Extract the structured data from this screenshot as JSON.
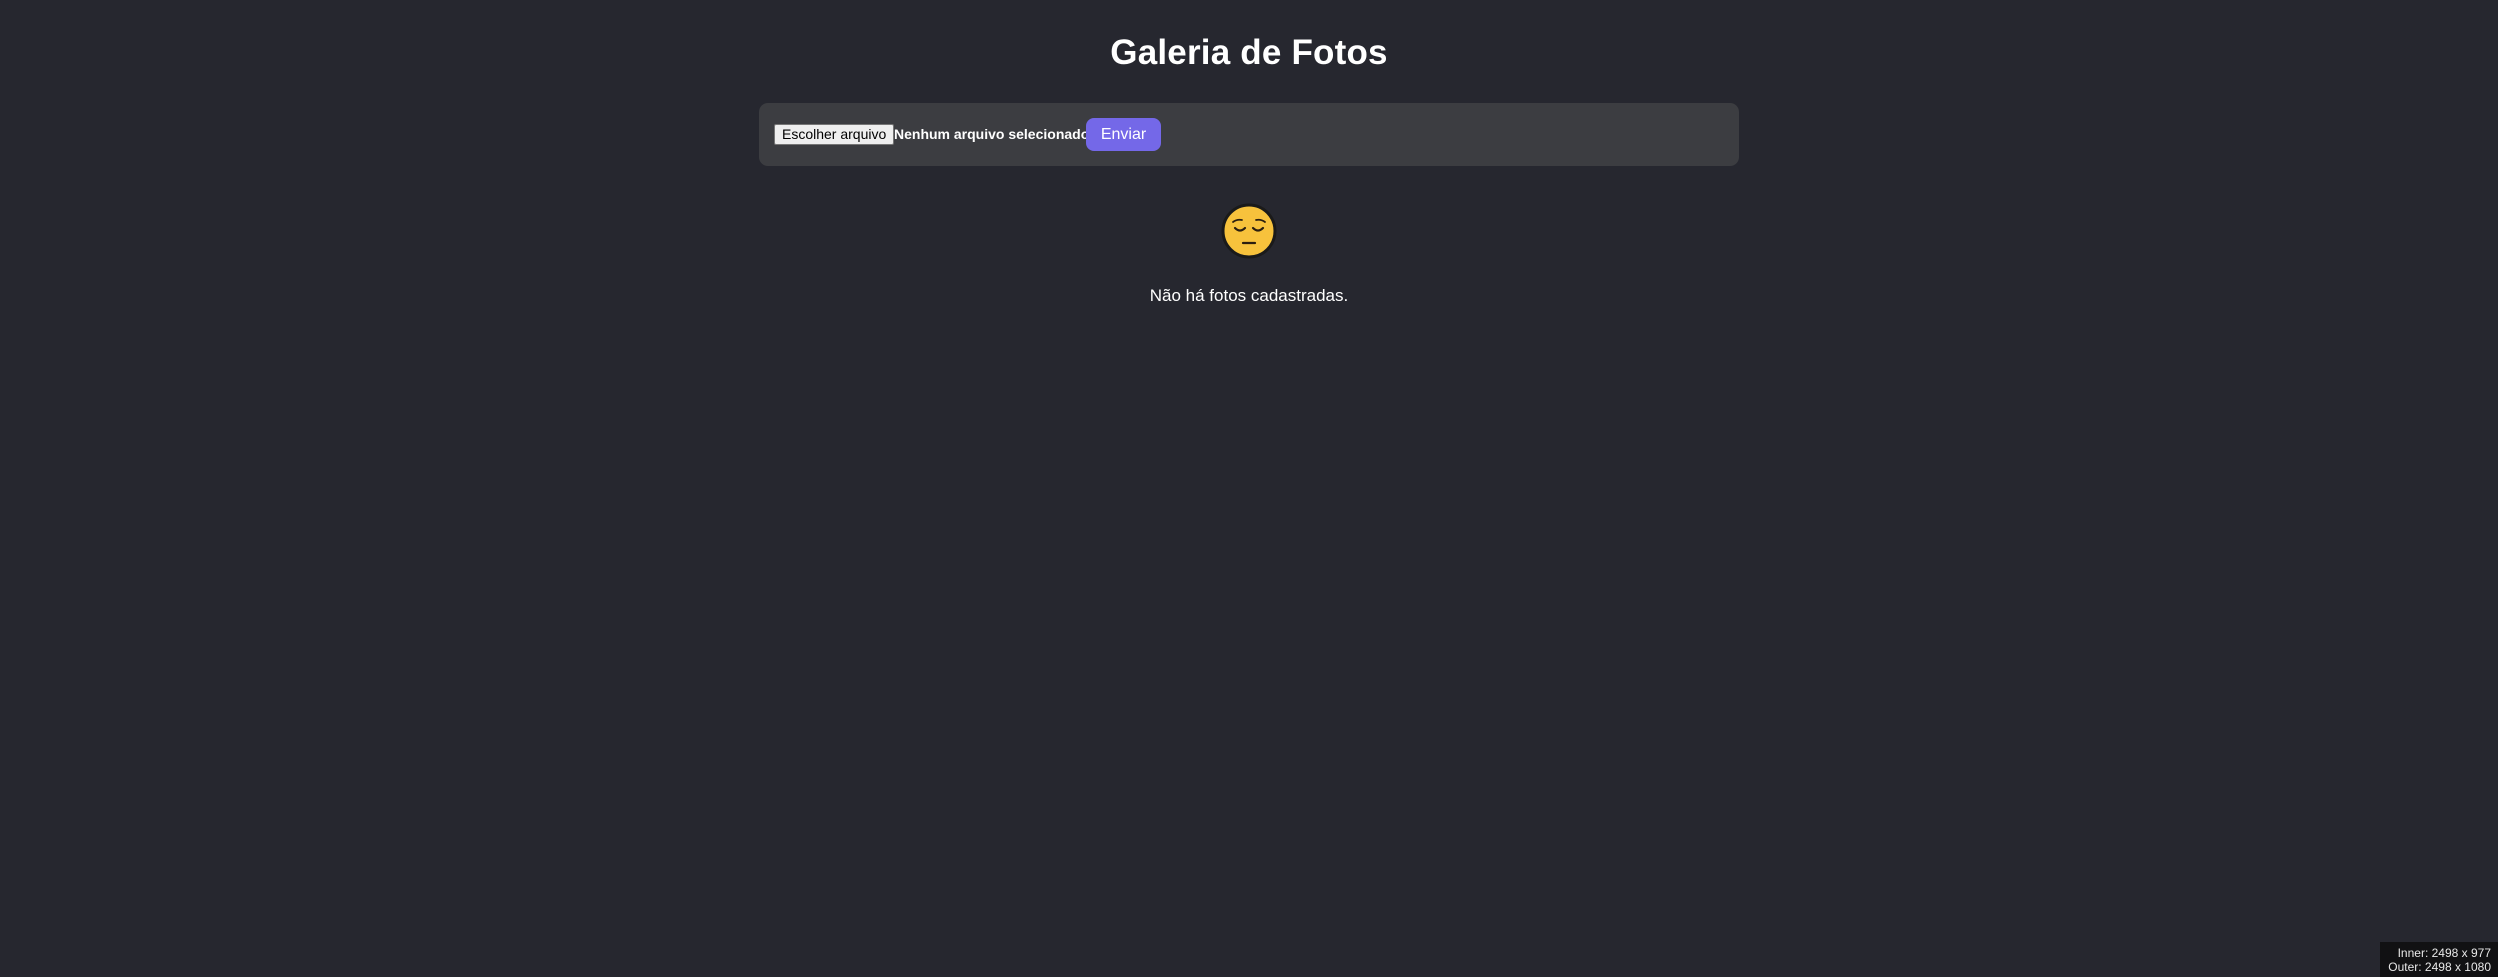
{
  "page": {
    "title": "Galeria de Fotos"
  },
  "upload": {
    "file_button_label": "Escolher arquivo",
    "file_status": "Nenhum arquivo selecionado",
    "submit_label": "Enviar"
  },
  "empty_state": {
    "icon": "pensive-face-icon",
    "message": "Não há fotos cadastradas."
  },
  "viewport_info": {
    "inner": "Inner: 2498 x 977",
    "outer": "Outer: 2498 x 1080"
  },
  "colors": {
    "background": "#26272f",
    "panel": "#3c3d41",
    "accent": "#7468e8"
  }
}
